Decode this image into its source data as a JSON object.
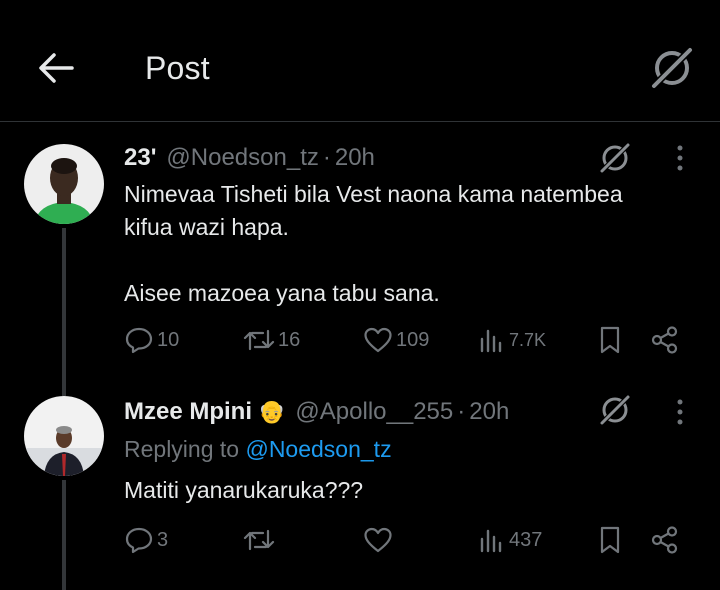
{
  "header": {
    "title": "Post",
    "back_icon": "arrow-left-icon",
    "grok_icon": "grok-icon"
  },
  "colors": {
    "background": "#000000",
    "text": "#e7e9ea",
    "muted": "#71767b",
    "link": "#1d9bf0",
    "divider": "#2f3336"
  },
  "tweets": [
    {
      "name": "23'",
      "handle": "@Noedson_tz",
      "dot": "·",
      "time": "20h",
      "text_lines": [
        "Nimevaa Tisheti bila Vest naona kama natembea",
        "kifua wazi hapa.",
        "",
        "Aisee mazoea yana tabu sana."
      ],
      "replies": "10",
      "reposts": "16",
      "likes": "109",
      "views": "7.7K"
    },
    {
      "name": "Mzee Mpini",
      "badge": "👴",
      "handle": "@Apollo__255",
      "dot": "·",
      "time": "20h",
      "replying_label": "Replying to",
      "replying_handle": "@Noedson_tz",
      "text_lines": [
        "Matiti yanarukaruka???"
      ],
      "replies": "3",
      "reposts": "",
      "likes": "",
      "views": "437"
    }
  ]
}
